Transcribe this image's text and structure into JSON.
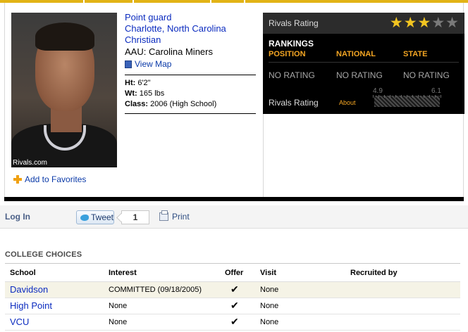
{
  "player": {
    "photo_credit": "Rivals.com",
    "position": "Point guard",
    "hometown": "Charlotte, North Carolina",
    "school": "Christian",
    "aau": "AAU: Carolina Miners",
    "view_map": "View Map",
    "add_favorites": "Add to Favorites",
    "height_label": "Ht:",
    "height": "6'2\"",
    "weight_label": "Wt:",
    "weight": "165 lbs",
    "class_label": "Class:",
    "class": "2006 (High School)"
  },
  "rivals": {
    "header": "Rivals Rating",
    "stars_filled": 3,
    "stars_total": 5,
    "star_color": "#f2c521",
    "rankings_title": "RANKINGS",
    "columns": [
      "POSITION",
      "NATIONAL",
      "STATE"
    ],
    "values": [
      "NO RATING",
      "NO RATING",
      "NO RATING"
    ],
    "rating_label": "Rivals Rating",
    "about": "About",
    "scale_min": "4.9",
    "scale_max": "6.1"
  },
  "actions": {
    "login": "Log In",
    "tweet": "Tweet",
    "tweet_count": "1",
    "print": "Print"
  },
  "college_choices": {
    "title": "COLLEGE CHOICES",
    "headers": [
      "School",
      "Interest",
      "Offer",
      "Visit",
      "Recruited by"
    ],
    "rows": [
      {
        "school": "Davidson",
        "interest": "COMMITTED (09/18/2005)",
        "offer": "✔",
        "visit": "None",
        "recruited_by": ""
      },
      {
        "school": "High Point",
        "interest": "None",
        "offer": "✔",
        "visit": "None",
        "recruited_by": ""
      },
      {
        "school": "VCU",
        "interest": "None",
        "offer": "✔",
        "visit": "None",
        "recruited_by": ""
      }
    ]
  }
}
